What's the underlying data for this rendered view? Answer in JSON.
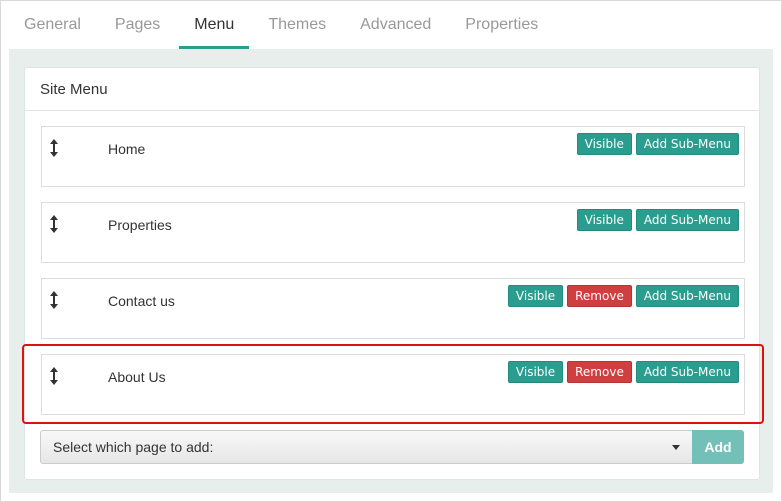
{
  "tabs": [
    {
      "label": "General",
      "active": false
    },
    {
      "label": "Pages",
      "active": false
    },
    {
      "label": "Menu",
      "active": true
    },
    {
      "label": "Themes",
      "active": false
    },
    {
      "label": "Advanced",
      "active": false
    },
    {
      "label": "Properties",
      "active": false
    }
  ],
  "panel": {
    "title": "Site Menu"
  },
  "menu_items": [
    {
      "label": "Home",
      "visible_label": "Visible",
      "add_sub_label": "Add Sub-Menu"
    },
    {
      "label": "Properties",
      "visible_label": "Visible",
      "add_sub_label": "Add Sub-Menu"
    },
    {
      "label": "Contact us",
      "visible_label": "Visible",
      "remove_label": "Remove",
      "add_sub_label": "Add Sub-Menu"
    },
    {
      "label": "About Us",
      "visible_label": "Visible",
      "remove_label": "Remove",
      "add_sub_label": "Add Sub-Menu"
    }
  ],
  "add_page": {
    "select_value": "Select which page to add:",
    "add_label": "Add"
  },
  "icons": {
    "drag_handle": "vertical-arrows-icon",
    "select_caret": "caret-down-icon"
  },
  "colors": {
    "accent": "#2a9d8f",
    "danger": "#cf3f3f",
    "add_button": "#72c0b8",
    "highlight_box": "#e01010"
  }
}
